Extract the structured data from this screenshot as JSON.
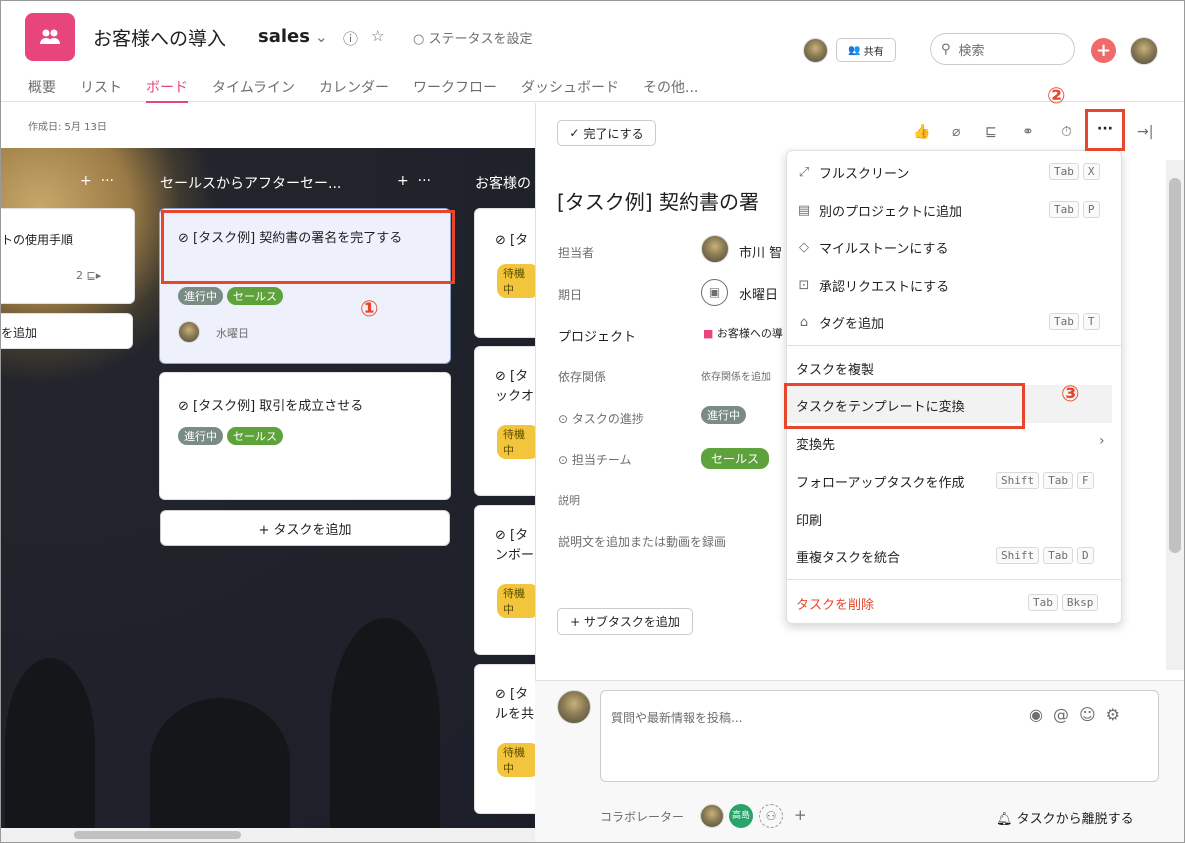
{
  "header": {
    "title": "お客様への導入",
    "project": "sales",
    "status": "ステータスを設定",
    "share": "共有",
    "search_placeholder": "検索"
  },
  "tabs": [
    "概要",
    "リスト",
    "ボード",
    "タイムライン",
    "カレンダー",
    "ワークフロー",
    "ダッシュボード",
    "その他..."
  ],
  "active_tab": "ボード",
  "board": {
    "created": "作成日: 5月 13日",
    "col0": {
      "card_title": "トの使用手順",
      "count": "2",
      "add": "を追加"
    },
    "col1": {
      "name": "セールスからアフターセー...",
      "card1": {
        "title": "[タスク例] 契約書の署名を完了する",
        "tags": [
          "進行中",
          "セールス"
        ],
        "due": "水曜日"
      },
      "card2": {
        "title": "[タスク例] 取引を成立させる",
        "tags": [
          "進行中",
          "セールス"
        ]
      },
      "add_task": "+ タスクを追加"
    },
    "col2": {
      "name": "お客様の",
      "cards": [
        {
          "title": "[タ",
          "tag": "待機中"
        },
        {
          "title": "[タ",
          "title2": "ックオ",
          "tag": "待機中"
        },
        {
          "title": "[タ",
          "title2": "ンボー",
          "tag": "待機中"
        },
        {
          "title": "[タ",
          "title2": "ルを共",
          "tag": "待機中"
        }
      ]
    }
  },
  "task": {
    "complete": "完了にする",
    "title": "[タスク例] 契約書の署",
    "fields": {
      "assignee_label": "担当者",
      "assignee": "市川 智",
      "due_label": "期日",
      "due": "水曜日",
      "project_label": "プロジェクト",
      "project": "お客様への導",
      "dep_label": "依存関係",
      "dep": "依存関係を追加",
      "progress_label": "タスクの進捗",
      "progress": "進行中",
      "team_label": "担当チーム",
      "team": "セールス",
      "desc_label": "説明",
      "desc_placeholder": "説明文を追加または動画を録画"
    },
    "add_subtask": "+ サブタスクを追加",
    "comment_placeholder": "質問や最新情報を投稿...",
    "collaborators": "コラボレーター",
    "collab_badge": "高島",
    "leave": "タスクから離脱する"
  },
  "menu": [
    {
      "label": "フルスクリーン",
      "icon": "expand-icon",
      "keys": [
        "Tab",
        "X"
      ]
    },
    {
      "label": "別のプロジェクトに追加",
      "icon": "project-icon",
      "keys": [
        "Tab",
        "P"
      ]
    },
    {
      "label": "マイルストーンにする",
      "icon": "diamond-icon",
      "keys": []
    },
    {
      "label": "承認リクエストにする",
      "icon": "approval-icon",
      "keys": []
    },
    {
      "label": "タグを追加",
      "icon": "tag-icon",
      "keys": [
        "Tab",
        "T"
      ]
    },
    {
      "label": "タスクを複製",
      "keys": []
    },
    {
      "label": "タスクをテンプレートに変換",
      "keys": []
    },
    {
      "label": "変換先",
      "keys": []
    },
    {
      "label": "フォローアップタスクを作成",
      "keys": [
        "Shift",
        "Tab",
        "F"
      ]
    },
    {
      "label": "印刷",
      "keys": []
    },
    {
      "label": "重複タスクを統合",
      "keys": [
        "Shift",
        "Tab",
        "D"
      ]
    },
    {
      "label": "タスクを削除",
      "keys": [
        "Tab",
        "Bksp"
      ]
    }
  ],
  "annotations": [
    "①",
    "②",
    "③"
  ],
  "colors": {
    "accent": "#e8457c",
    "highlight": "#e8462c",
    "sales_tag": "#5da23a",
    "wait_tag": "#f2c53d"
  }
}
